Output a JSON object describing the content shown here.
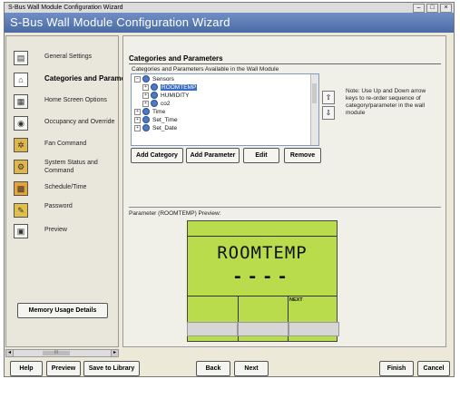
{
  "window": {
    "title": "S-Bus Wall Module Configuration Wizard",
    "header": "S-Bus Wall Module Configuration Wizard"
  },
  "sidebar": {
    "items": [
      {
        "label": "General Settings"
      },
      {
        "label": "Categories and Parame"
      },
      {
        "label": "Home Screen Options"
      },
      {
        "label": "Occupancy and Override"
      },
      {
        "label": "Fan Command"
      },
      {
        "label": "System Status and Command"
      },
      {
        "label": "Schedule/Time"
      },
      {
        "label": "Password"
      },
      {
        "label": "Preview"
      }
    ],
    "memory_button": "Memory Usage Details",
    "scroll_thumb_label": "III"
  },
  "main": {
    "title": "Categories and Parameters",
    "subtitle": "Categories and Parameters Available in the Wall Module",
    "tree": [
      {
        "label": "Sensors",
        "expander": "–"
      },
      {
        "label": "ROOMTEMP",
        "expander": "+"
      },
      {
        "label": "HUMIDITY",
        "expander": "+"
      },
      {
        "label": "co2",
        "expander": "+"
      },
      {
        "label": "Time",
        "expander": "+"
      },
      {
        "label": "Set_Time",
        "expander": "+"
      },
      {
        "label": "Set_Date",
        "expander": "+"
      }
    ],
    "note": "Note: Use Up and Down arrow keys to re-order sequence of category/parameter in the wall module",
    "buttons": {
      "add_category": "Add Category",
      "add_parameter": "Add Parameter",
      "edit": "Edit",
      "remove": "Remove"
    },
    "preview_label": "Parameter (ROOMTEMP) Preview:",
    "lcd": {
      "main_text": "ROOMTEMP",
      "value_text": "----",
      "softkey_label": "NEXT"
    }
  },
  "footer": {
    "help": "Help",
    "preview": "Preview",
    "save": "Save to Library",
    "back": "Back",
    "next": "Next",
    "finish": "Finish",
    "cancel": "Cancel"
  }
}
